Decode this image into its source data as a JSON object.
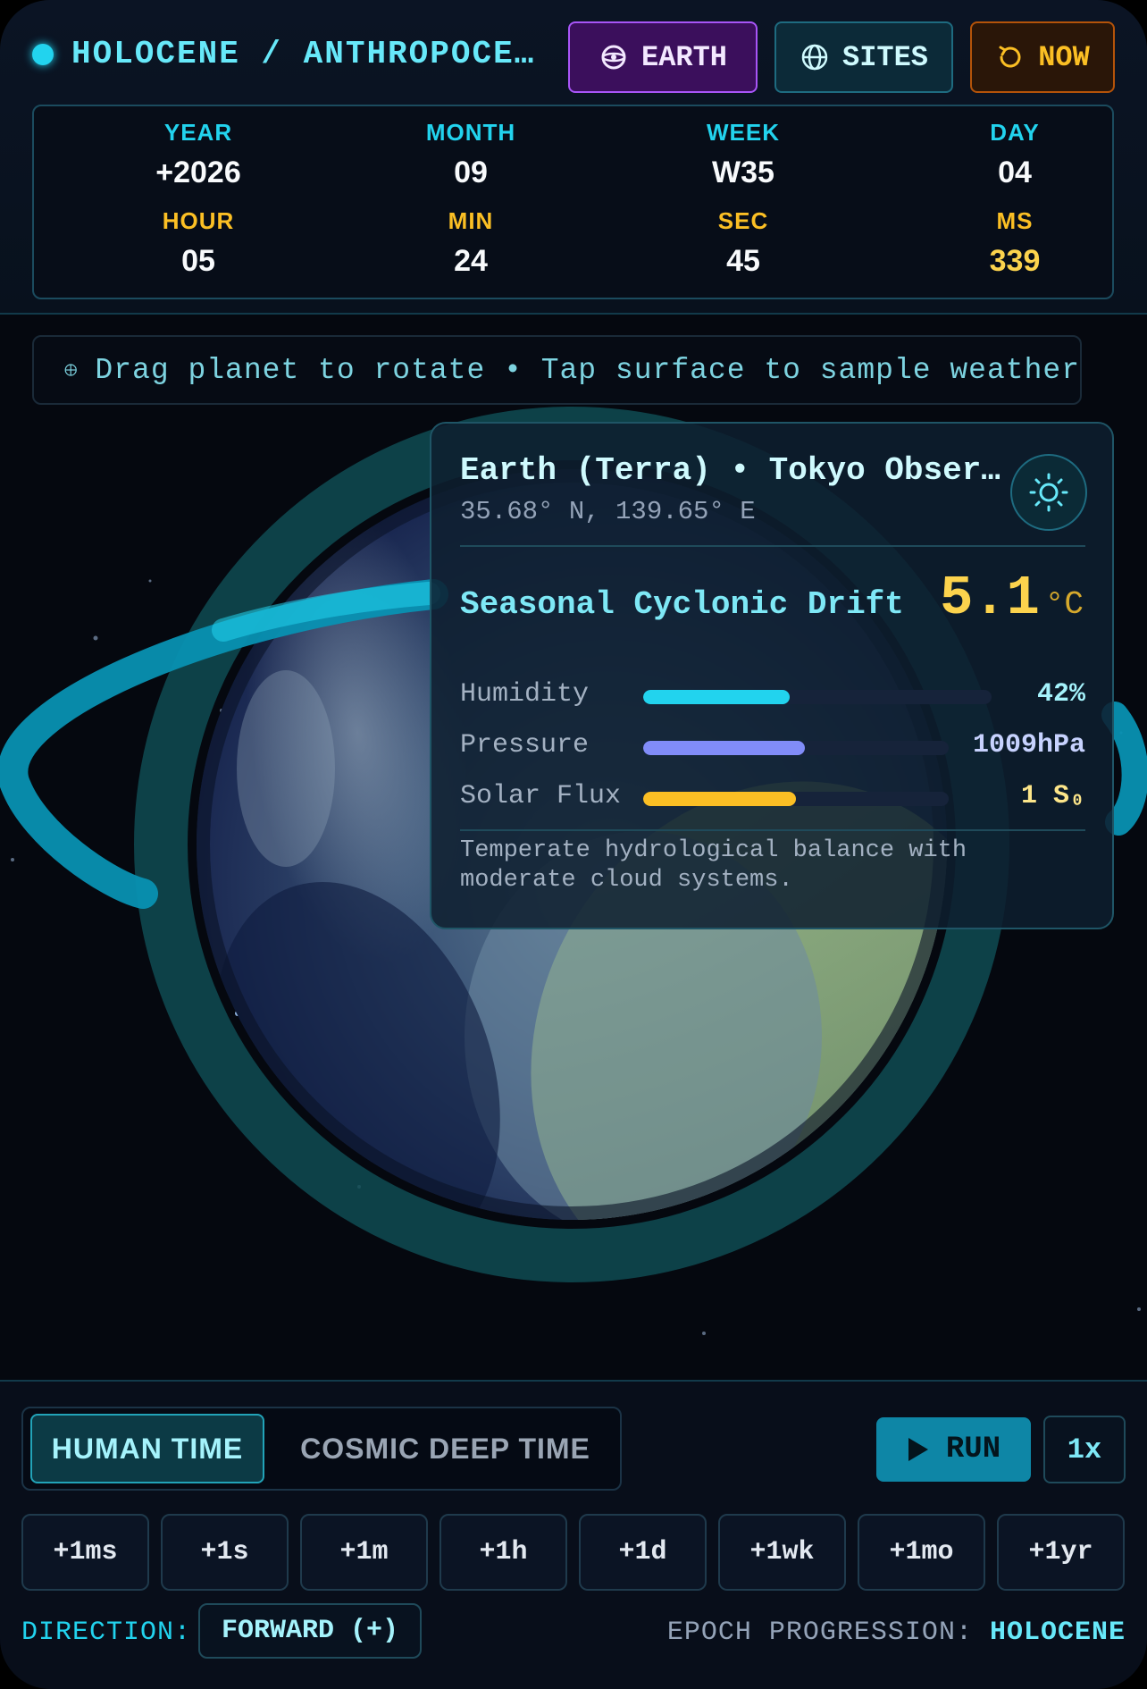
{
  "header": {
    "era": "HOLOCENE / ANTHROPOCE…",
    "buttons": {
      "earth": "EARTH",
      "sites": "SITES",
      "now": "NOW"
    },
    "clock": {
      "year_label": "YEAR",
      "year": "+2026",
      "month_label": "MONTH",
      "month": "09",
      "week_label": "WEEK",
      "week": "W35",
      "day_label": "DAY",
      "day": "04",
      "hour_label": "HOUR",
      "hour": "05",
      "min_label": "MIN",
      "min": "24",
      "sec_label": "SEC",
      "sec": "45",
      "ms_label": "MS",
      "ms": "339"
    }
  },
  "hint": "Drag planet to rotate • Tap surface to sample weather",
  "weather": {
    "title": "Earth (Terra) • Tokyo Obser…",
    "coords": "35.68° N, 139.65° E",
    "condition": "Seasonal Cyclonic Drift",
    "temperature": "5.1",
    "temperature_unit": "°C",
    "metrics": [
      {
        "label": "Humidity",
        "value": "42%",
        "level": 0.42,
        "color": "#22d3ee"
      },
      {
        "label": "Pressure",
        "value": "1009hPa",
        "level": 0.53,
        "color": "#818cf8"
      },
      {
        "label": "Solar Flux",
        "value": "1 S₀",
        "level": 0.5,
        "color": "#fbbf24"
      }
    ],
    "description": "Temperate hydrological balance with moderate cloud systems."
  },
  "controls": {
    "mode_human": "HUMAN TIME",
    "mode_cosmic": "COSMIC DEEP TIME",
    "run": "RUN",
    "speed": "1x",
    "steps": [
      "+1ms",
      "+1s",
      "+1m",
      "+1h",
      "+1d",
      "+1wk",
      "+1mo",
      "+1yr"
    ],
    "direction_label": "DIRECTION:",
    "direction": "FORWARD (+)",
    "epoch_label": "EPOCH PROGRESSION:",
    "epoch": "HOLOCENE"
  },
  "icons": {
    "earth": "planet-icon",
    "sites": "globe-icon",
    "now": "reset-icon",
    "hint": "crosshair-icon",
    "weather": "sun-icon",
    "run": "play-icon"
  },
  "colors": {
    "accent": "#22d3ee",
    "amber": "#fbbf24",
    "purple": "#a855f7",
    "background": "#05080f"
  }
}
